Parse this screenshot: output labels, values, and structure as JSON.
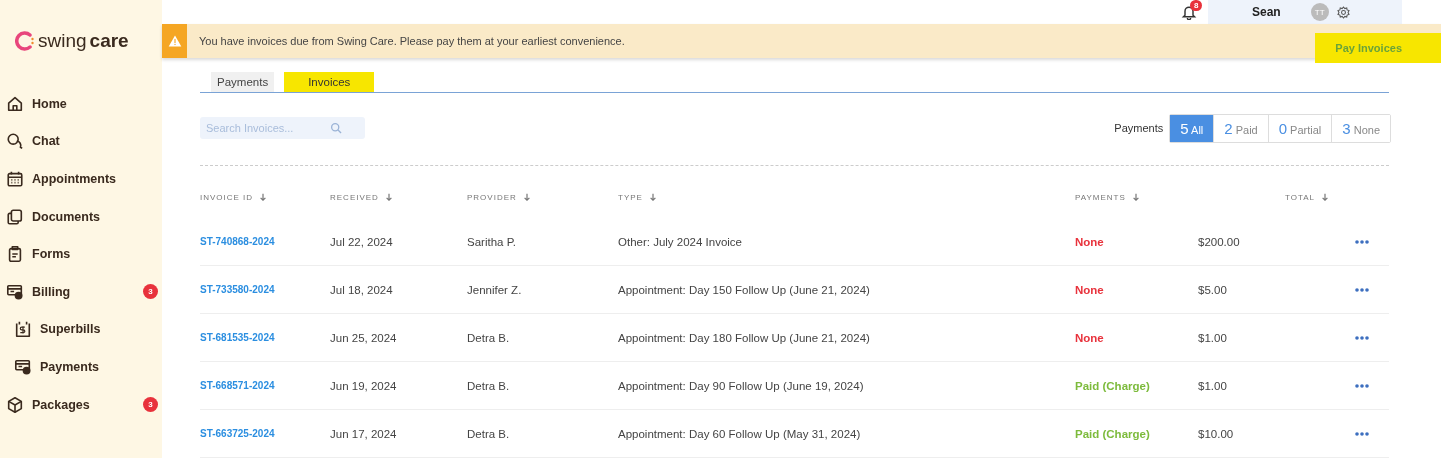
{
  "sidebar": {
    "logo": {
      "word_light": "swing",
      "word_bold": "care"
    },
    "items": [
      {
        "label": "Home"
      },
      {
        "label": "Chat"
      },
      {
        "label": "Appointments"
      },
      {
        "label": "Documents"
      },
      {
        "label": "Forms"
      },
      {
        "label": "Billing",
        "badge": "3",
        "children": [
          {
            "label": "Superbills"
          },
          {
            "label": "Payments"
          }
        ]
      },
      {
        "label": "Packages",
        "badge": "3"
      }
    ]
  },
  "topbar": {
    "notifications": "8",
    "user": "Sean",
    "avatar": "TT"
  },
  "banner": {
    "message": "You have invoices due from Swing Care. Please pay them at your earliest convenience.",
    "action": "Pay Invoices",
    "action_highlighted": true
  },
  "tabs": [
    {
      "label": "Payments",
      "selected": false,
      "highlighted": false
    },
    {
      "label": "Invoices",
      "selected": true,
      "highlighted": true
    }
  ],
  "search": {
    "placeholder": "Search Invoices..."
  },
  "filter": {
    "label": "Payments",
    "options": [
      {
        "count": "5",
        "label": "All",
        "selected": true
      },
      {
        "count": "2",
        "label": "Paid",
        "selected": false
      },
      {
        "count": "0",
        "label": "Partial",
        "selected": false
      },
      {
        "count": "3",
        "label": "None",
        "selected": false
      }
    ]
  },
  "table": {
    "columns": [
      "INVOICE ID",
      "RECEIVED",
      "PROVIDER",
      "TYPE",
      "PAYMENTS",
      "TOTAL"
    ],
    "rows": [
      {
        "id": "ST-740868-2024",
        "received": "Jul 22, 2024",
        "provider": "Saritha P.",
        "type": "Other: July 2024 Invoice",
        "payment": {
          "text": "None",
          "kind": "unpaid"
        },
        "total": "$200.00"
      },
      {
        "id": "ST-733580-2024",
        "received": "Jul 18, 2024",
        "provider": "Jennifer Z.",
        "type": "Appointment: Day 150 Follow Up (June 21, 2024)",
        "payment": {
          "text": "None",
          "kind": "unpaid"
        },
        "total": "$5.00"
      },
      {
        "id": "ST-681535-2024",
        "received": "Jun 25, 2024",
        "provider": "Detra B.",
        "type": "Appointment: Day 180 Follow Up (June 21, 2024)",
        "payment": {
          "text": "None",
          "kind": "unpaid"
        },
        "total": "$1.00"
      },
      {
        "id": "ST-668571-2024",
        "received": "Jun 19, 2024",
        "provider": "Detra B.",
        "type": "Appointment: Day 90 Follow Up (June 19, 2024)",
        "payment": {
          "text": "Paid (Charge)",
          "kind": "paid"
        },
        "total": "$1.00"
      },
      {
        "id": "ST-663725-2024",
        "received": "Jun 17, 2024",
        "provider": "Detra B.",
        "type": "Appointment: Day 60 Follow Up (May 31, 2024)",
        "payment": {
          "text": "Paid (Charge)",
          "kind": "paid"
        },
        "total": "$10.00"
      }
    ]
  }
}
